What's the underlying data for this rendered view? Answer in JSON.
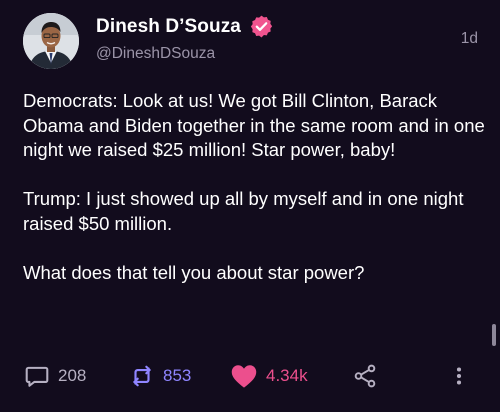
{
  "post": {
    "author_name": "Dinesh D’Souza",
    "handle": "@DineshDSouza",
    "time": "1d",
    "paragraphs": [
      "Democrats: Look at us! We got Bill Clinton, Barack Obama and Biden together in the same room and in one night we raised $25 million! Star power, baby!",
      "Trump: I just showed up all by myself and in one night raised $50 million.",
      "What does that tell you about star power?"
    ]
  },
  "actions": {
    "reply_count": "208",
    "repost_count": "853",
    "like_count": "4.34k"
  },
  "icons": {
    "avatar": "avatar",
    "verified": "verified-badge-icon",
    "reply": "reply-icon",
    "repost": "repost-icon",
    "like": "heart-icon",
    "share": "share-icon",
    "more": "more-icon"
  },
  "colors": {
    "background": "#120c1d",
    "secondary_text": "#9b94a8",
    "like_accent": "#ec4f8d",
    "verified_badge": "#f0548f"
  }
}
